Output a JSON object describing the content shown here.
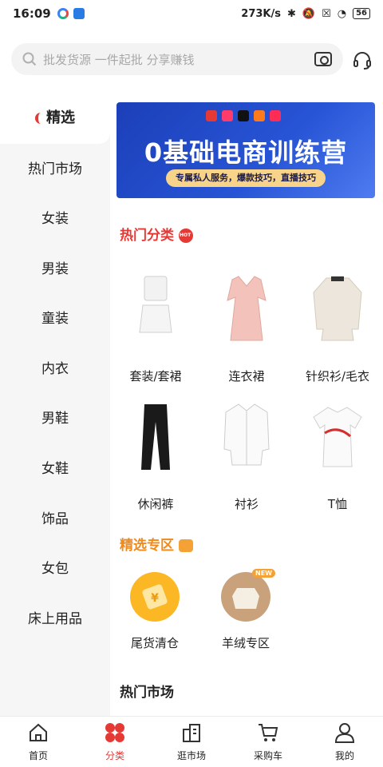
{
  "status_bar": {
    "time": "16:09",
    "network_speed": "273K/s",
    "battery": "56"
  },
  "search": {
    "placeholder": "批发货源 一件起批 分享赚钱"
  },
  "sidebar": {
    "items": [
      {
        "label": "精选",
        "active": true
      },
      {
        "label": "热门市场"
      },
      {
        "label": "女装"
      },
      {
        "label": "男装"
      },
      {
        "label": "童装"
      },
      {
        "label": "内衣"
      },
      {
        "label": "男鞋"
      },
      {
        "label": "女鞋"
      },
      {
        "label": "饰品"
      },
      {
        "label": "女包"
      },
      {
        "label": "床上用品"
      }
    ]
  },
  "banner": {
    "title": "0基础电商训练营",
    "subtitle": "专属私人服务，爆款技巧，直播技巧",
    "logo_colors": [
      "#e53935",
      "#ff3b6b",
      "#111111",
      "#ff7a1a",
      "#ff2d55"
    ]
  },
  "sections": {
    "hot_categories": {
      "title": "热门分类",
      "items": [
        {
          "label": "套装/套裙"
        },
        {
          "label": "连衣裙"
        },
        {
          "label": "针织衫/毛衣"
        },
        {
          "label": "休闲裤"
        },
        {
          "label": "衬衫"
        },
        {
          "label": "T恤"
        }
      ]
    },
    "featured": {
      "title": "精选专区",
      "items": [
        {
          "label": "尾货清仓"
        },
        {
          "label": "羊绒专区",
          "badge": "NEW"
        }
      ]
    },
    "hot_markets": {
      "title": "热门市场"
    }
  },
  "tabbar": {
    "items": [
      {
        "label": "首页"
      },
      {
        "label": "分类",
        "active": true
      },
      {
        "label": "逛市场"
      },
      {
        "label": "采购车"
      },
      {
        "label": "我的"
      }
    ]
  },
  "colors": {
    "accent": "#e53935",
    "featured": "#f08a1c"
  }
}
